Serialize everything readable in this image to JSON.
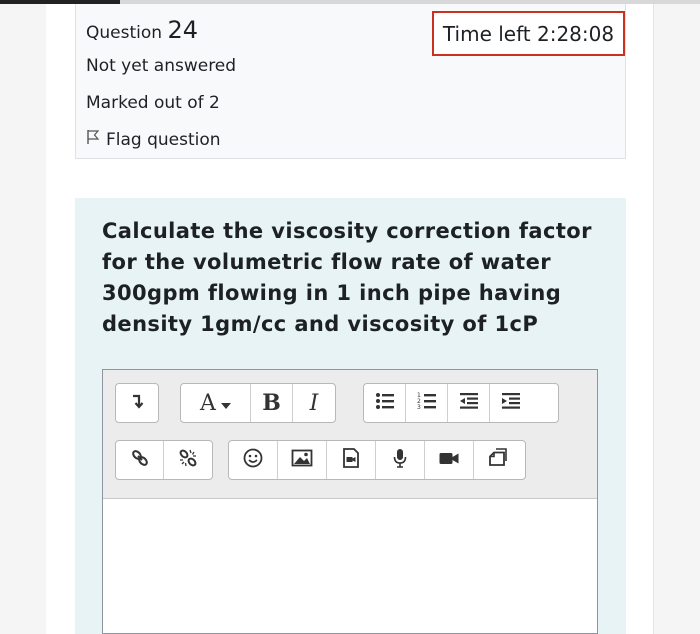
{
  "question": {
    "label": "Question",
    "number": "24",
    "state": "Not yet answered",
    "marks": "Marked out of 2",
    "flag_label": "Flag question"
  },
  "timer": {
    "text": "Time left 2:28:08"
  },
  "question_text": "Calculate the viscosity correction factor for the volumetric flow rate of water 300gpm flowing in 1 inch pipe having density 1gm/cc and viscosity of 1cP",
  "editor": {
    "font_label": "A",
    "bold_label": "B",
    "italic_label": "I",
    "content": ""
  },
  "colors": {
    "timer_border": "#ca3120",
    "formulation_bg": "#e7f3f5",
    "info_bg": "#f8f9fa"
  }
}
